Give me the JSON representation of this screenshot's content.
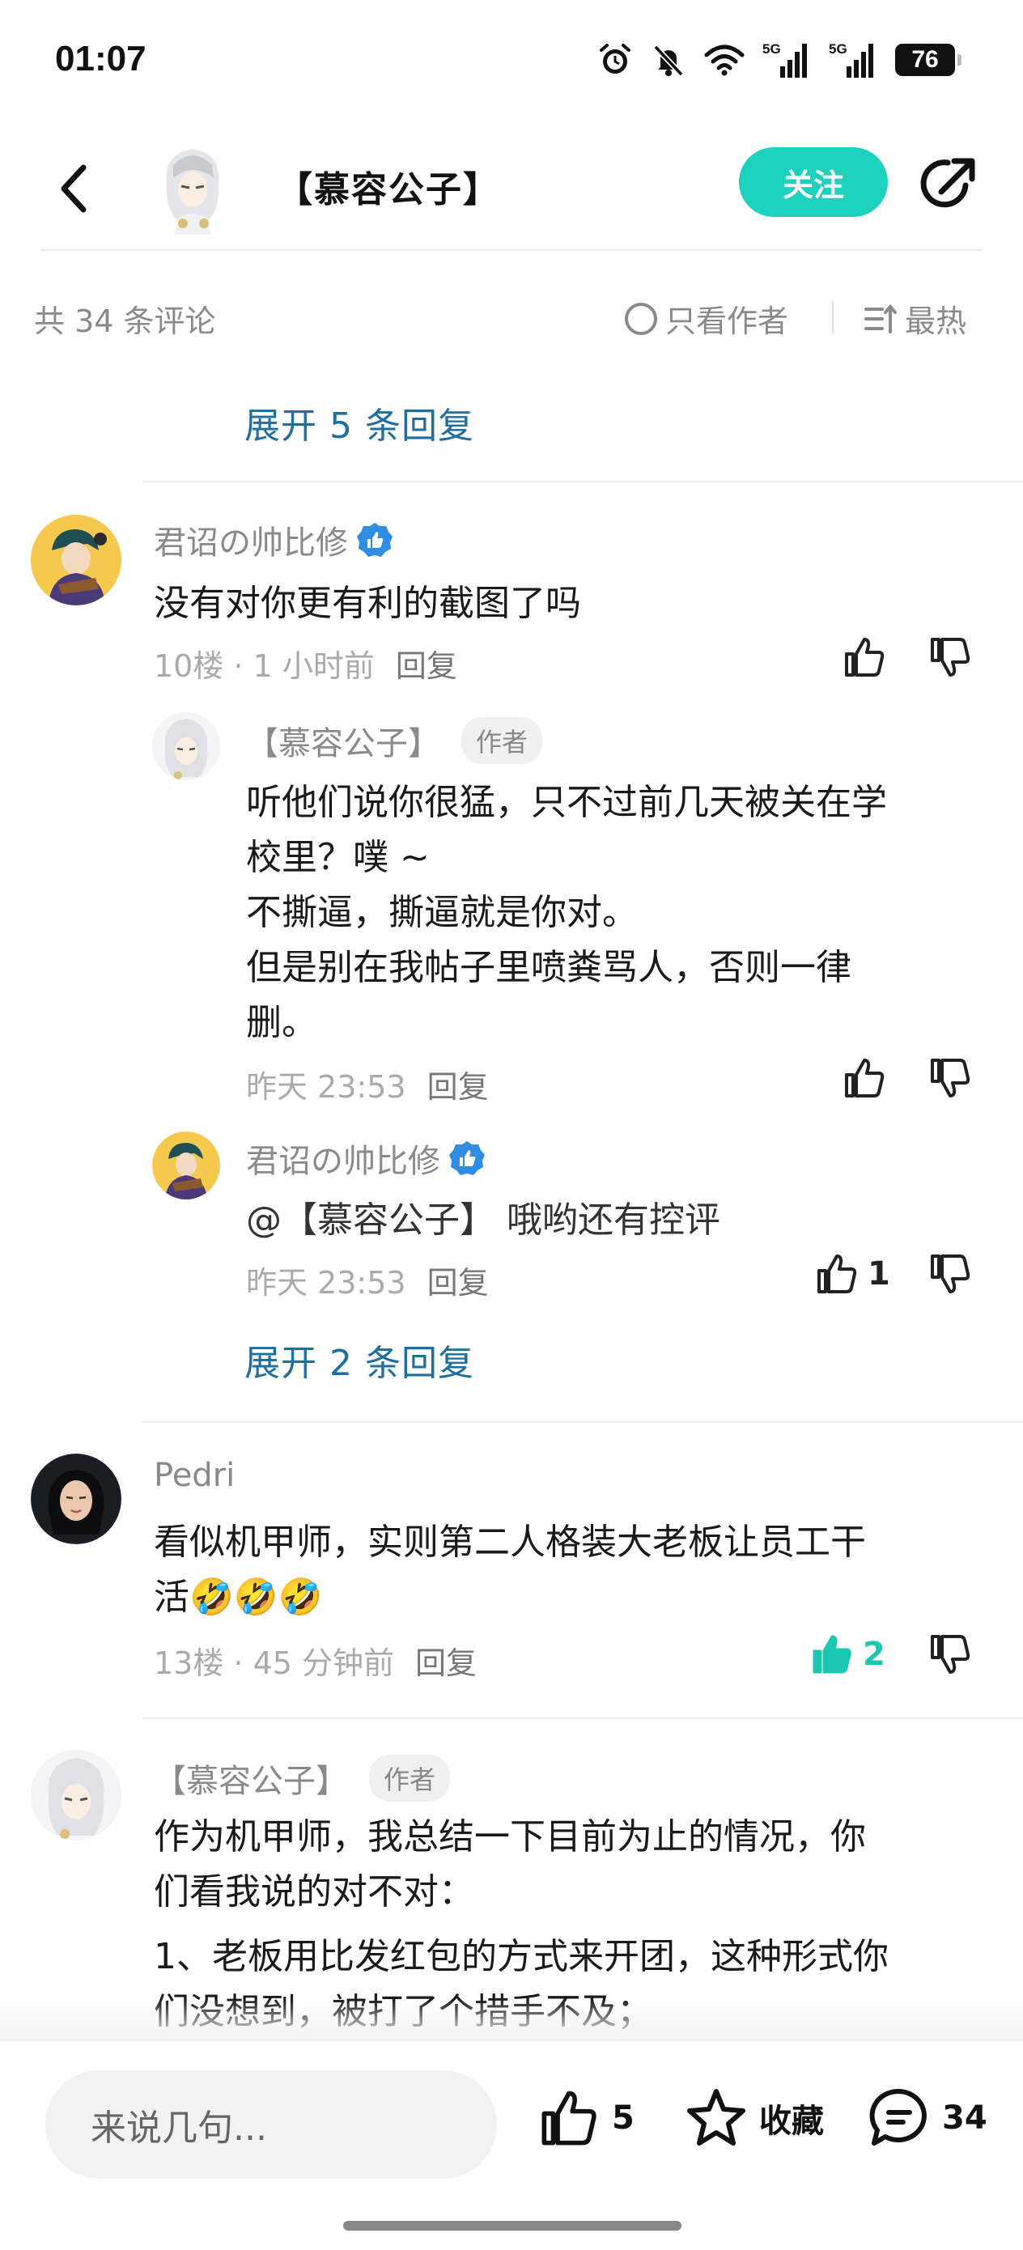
{
  "status_bar": {
    "time": "01:07",
    "signal_1": "5G",
    "signal_2": "5G",
    "battery": "76",
    "icons": [
      "alarm-icon",
      "mute-bell-icon",
      "wifi-icon",
      "signal-5g-icon",
      "signal-5g-icon",
      "battery-icon"
    ]
  },
  "header": {
    "title": "【慕容公子】",
    "follow_label": "关注"
  },
  "comment_bar": {
    "count_label": "共 34 条评论",
    "author_only_label": "只看作者",
    "sort_label": "最热"
  },
  "top_expand": "展开 5 条回复",
  "comments": [
    {
      "user": "君诏の帅比修",
      "text": "没有对你更有利的截图了吗",
      "floor_time": "10楼 · 1 小时前",
      "reply_label": "回复",
      "replies": [
        {
          "user": "【慕容公子】",
          "tag": "作者",
          "text_lines": [
            "听他们说你很猛，只不过前几天被关在学",
            "校里？噗 ~",
            "不撕逼，撕逼就是你对。",
            "但是别在我帖子里喷粪骂人，否则一律",
            "删。"
          ],
          "time": "昨天 23:53",
          "reply_label": "回复"
        },
        {
          "user": "君诏の帅比修",
          "text": "@【慕容公子】  哦哟还有控评",
          "time": "昨天 23:53",
          "reply_label": "回复",
          "likes": "1"
        }
      ],
      "expand_label": "展开 2 条回复"
    },
    {
      "user": "Pedri",
      "text_lines": [
        "看似机甲师，实则第二人格装大老板让员工干",
        "活🤣🤣🤣"
      ],
      "floor_time": "13楼 · 45 分钟前",
      "reply_label": "回复",
      "likes": "2"
    },
    {
      "user": "【慕容公子】",
      "tag": "作者",
      "text_lines": [
        "作为机甲师，我总结一下目前为止的情况，你",
        "们看我说的对不对：",
        "1、老板用比发红包的方式来开团，这种形式你",
        "们没想到，被打了个措手不及；"
      ]
    }
  ],
  "bottom_bar": {
    "input_placeholder": "来说几句...",
    "like_count": "5",
    "favorite_label": "收藏",
    "comment_count": "34"
  }
}
